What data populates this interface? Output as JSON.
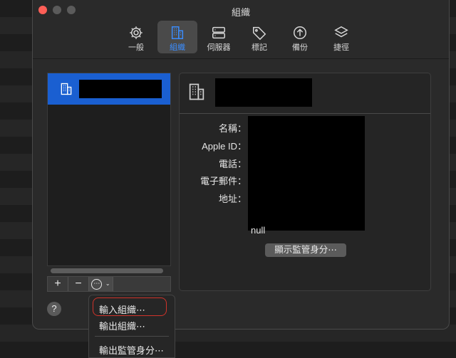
{
  "window": {
    "title": "組織"
  },
  "toolbar": {
    "items": [
      {
        "label": "一般",
        "icon": "gear-icon"
      },
      {
        "label": "組織",
        "icon": "building-icon",
        "active": true
      },
      {
        "label": "伺服器",
        "icon": "server-icon"
      },
      {
        "label": "標記",
        "icon": "tag-icon"
      },
      {
        "label": "備份",
        "icon": "backup-arrow-icon"
      },
      {
        "label": "捷徑",
        "icon": "layers-icon"
      }
    ]
  },
  "detail": {
    "labels": {
      "name": "名稱：",
      "apple_id": "Apple ID：",
      "phone": "電話：",
      "email": "電子郵件：",
      "address": "地址："
    },
    "null_value": "null",
    "show_button": "顯示監管身分⋯"
  },
  "buttons": {
    "add": "+",
    "remove": "−",
    "more": "⋯",
    "help": "?"
  },
  "menu": {
    "items": [
      "輸入組織⋯",
      "輸出組織⋯",
      "輸出監管身分⋯"
    ]
  },
  "colors": {
    "accent": "#1a5fd1",
    "active_label": "#3a8dff",
    "highlight_ring": "#d0332a"
  }
}
